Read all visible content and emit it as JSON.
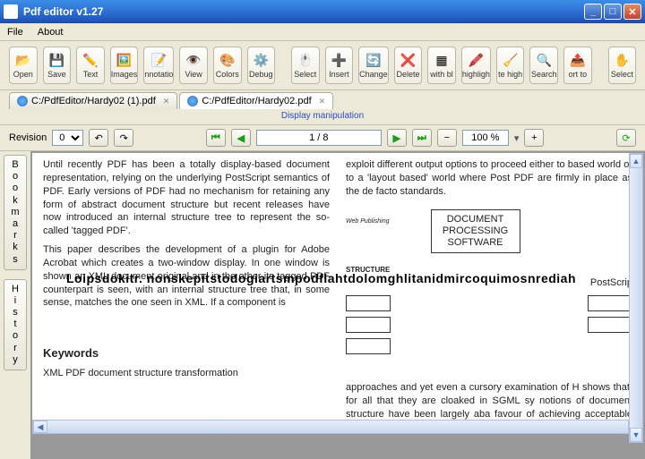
{
  "title": "Pdf editor v1.27",
  "menu": {
    "file": "File",
    "about": "About"
  },
  "toolbar": {
    "open": "Open",
    "save": "Save",
    "text": "Text",
    "images": "Images",
    "annot": "nnotatio",
    "view": "View",
    "colors": "Colors",
    "debug": "Debug",
    "select": "Select",
    "insert": "Insert",
    "change": "Change",
    "delete": "Delete",
    "withbl": "with bl",
    "highlight": "highligh",
    "dehigh": "te high",
    "search": "Search",
    "prtto": "ort to",
    "select2": "Select"
  },
  "tabs": [
    {
      "label": "C:/PdfEditor/Hardy02 (1).pdf",
      "active": false
    },
    {
      "label": "C:/PdfEditor/Hardy02.pdf",
      "active": true
    }
  ],
  "hint": "Display manipulation",
  "nav": {
    "revision_label": "Revision",
    "revision_value": "0",
    "page": "1 / 8",
    "zoom": "100 %"
  },
  "side": {
    "bookmarks": "Bookmarks",
    "history": "History"
  },
  "doc": {
    "p1": "Until recently PDF has been a totally display-based document representation, relying on the underlying PostScript semantics of PDF. Early versions of PDF had no mechanism for retaining any form of abstract document structure but recent releases have now introduced an internal structure tree to represent the so-called 'tagged PDF'.",
    "p2": "This paper describes the development of a plugin for Adobe Acrobat which creates a two-window display. In one window is shown an XML document original and in the other its tagged PDF counterpart is seen, with an internal structure tree that, in some sense, matches the one seen in XML. If a component is",
    "r1": "exploit different output options to proceed either to based world or to a 'layout based' world where Post PDF are firmly in place as the de facto standards.",
    "r2": "approaches and yet even a cursory examination of H shows that, for all that they are cloaked in SGML sy notions of document structure have been largely aba favour of achieving acceptable layout effects in bro",
    "diagram": {
      "l1": "DOCUMENT",
      "l2": "PROCESSING",
      "l3": "SOFTWARE"
    },
    "web": "Web Publishing",
    "structure": "STRUCTURE",
    "postscript": "PostScrip",
    "overlay": "Loipsdokitr. nonskepitstodogiartsmpodflahtdolomghlitanidmircoquimosnrediah",
    "keywords": "Keywords",
    "kw_line": "XML PDF document structure transformation"
  }
}
